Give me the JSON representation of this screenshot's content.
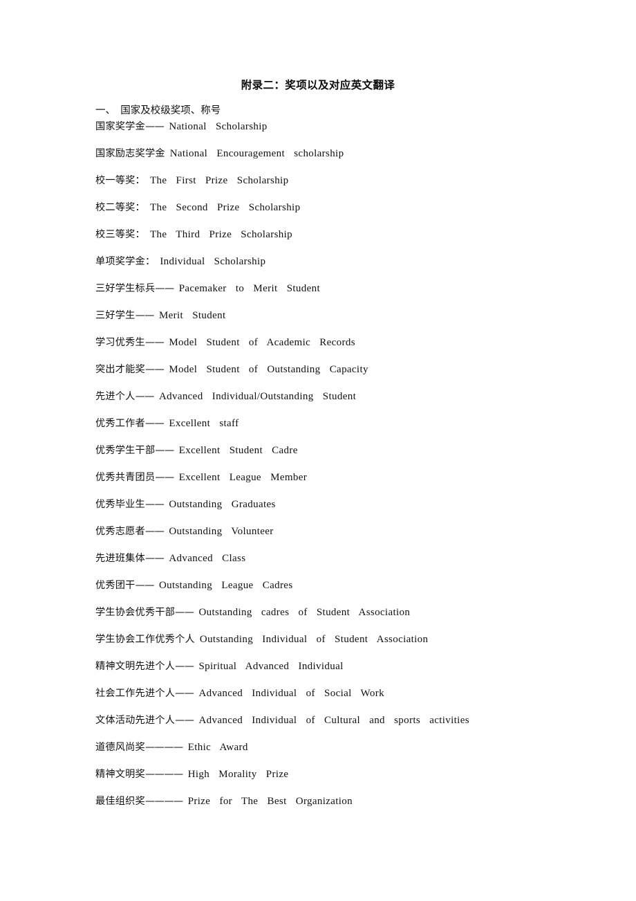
{
  "document": {
    "title": "附录二：奖项以及对应英文翻译",
    "section_heading": "一、  国家及校级奖项、称号",
    "entries": [
      {
        "cn": "国家奖学金",
        "sep": "——",
        "en": "National  Scholarship"
      },
      {
        "cn": "国家励志奖学金",
        "sep": "",
        "en": "National  Encouragement  scholarship"
      },
      {
        "cn": "校一等奖：",
        "sep": "",
        "en": "The  First  Prize  Scholarship"
      },
      {
        "cn": "校二等奖：",
        "sep": "",
        "en": "The  Second  Prize  Scholarship"
      },
      {
        "cn": "校三等奖：",
        "sep": "",
        "en": "The  Third  Prize  Scholarship"
      },
      {
        "cn": "单项奖学金：",
        "sep": "",
        "en": "Individual  Scholarship"
      },
      {
        "cn": "三好学生标兵",
        "sep": "——",
        "en": "Pacemaker  to  Merit  Student"
      },
      {
        "cn": "三好学生",
        "sep": "——",
        "en": "Merit  Student"
      },
      {
        "cn": "学习优秀生",
        "sep": "——",
        "en": "Model  Student  of  Academic  Records"
      },
      {
        "cn": "突出才能奖",
        "sep": "——",
        "en": "Model  Student  of  Outstanding  Capacity"
      },
      {
        "cn": "先进个人",
        "sep": "——",
        "en": "Advanced  Individual/Outstanding  Student"
      },
      {
        "cn": "优秀工作者",
        "sep": "——",
        "en": "Excellent  staff"
      },
      {
        "cn": "优秀学生干部",
        "sep": "——",
        "en": "Excellent  Student  Cadre"
      },
      {
        "cn": "优秀共青团员",
        "sep": "——",
        "en": "Excellent  League  Member"
      },
      {
        "cn": "优秀毕业生",
        "sep": "——",
        "en": "Outstanding  Graduates"
      },
      {
        "cn": "优秀志愿者",
        "sep": "——",
        "en": "Outstanding  Volunteer"
      },
      {
        "cn": "先进班集体",
        "sep": "——",
        "en": "Advanced  Class"
      },
      {
        "cn": "优秀团干",
        "sep": "——",
        "en": "Outstanding  League  Cadres"
      },
      {
        "cn": "学生协会优秀干部",
        "sep": "——",
        "en": "Outstanding  cadres  of  Student  Association"
      },
      {
        "cn": "学生协会工作优秀个人",
        "sep": "",
        "en": "Outstanding  Individual  of  Student  Association"
      },
      {
        "cn": "精神文明先进个人",
        "sep": "——",
        "en": "Spiritual  Advanced  Individual"
      },
      {
        "cn": "社会工作先进个人",
        "sep": "——",
        "en": "Advanced  Individual  of  Social  Work"
      },
      {
        "cn": "文体活动先进个人",
        "sep": "——",
        "en": "Advanced  Individual  of  Cultural  and  sports  activities"
      },
      {
        "cn": "道德风尚奖",
        "sep": "————",
        "en": "Ethic  Award"
      },
      {
        "cn": "精神文明奖",
        "sep": "————",
        "en": "High  Morality  Prize"
      },
      {
        "cn": "最佳组织奖",
        "sep": "————",
        "en": "Prize  for  The  Best  Organization"
      }
    ]
  }
}
